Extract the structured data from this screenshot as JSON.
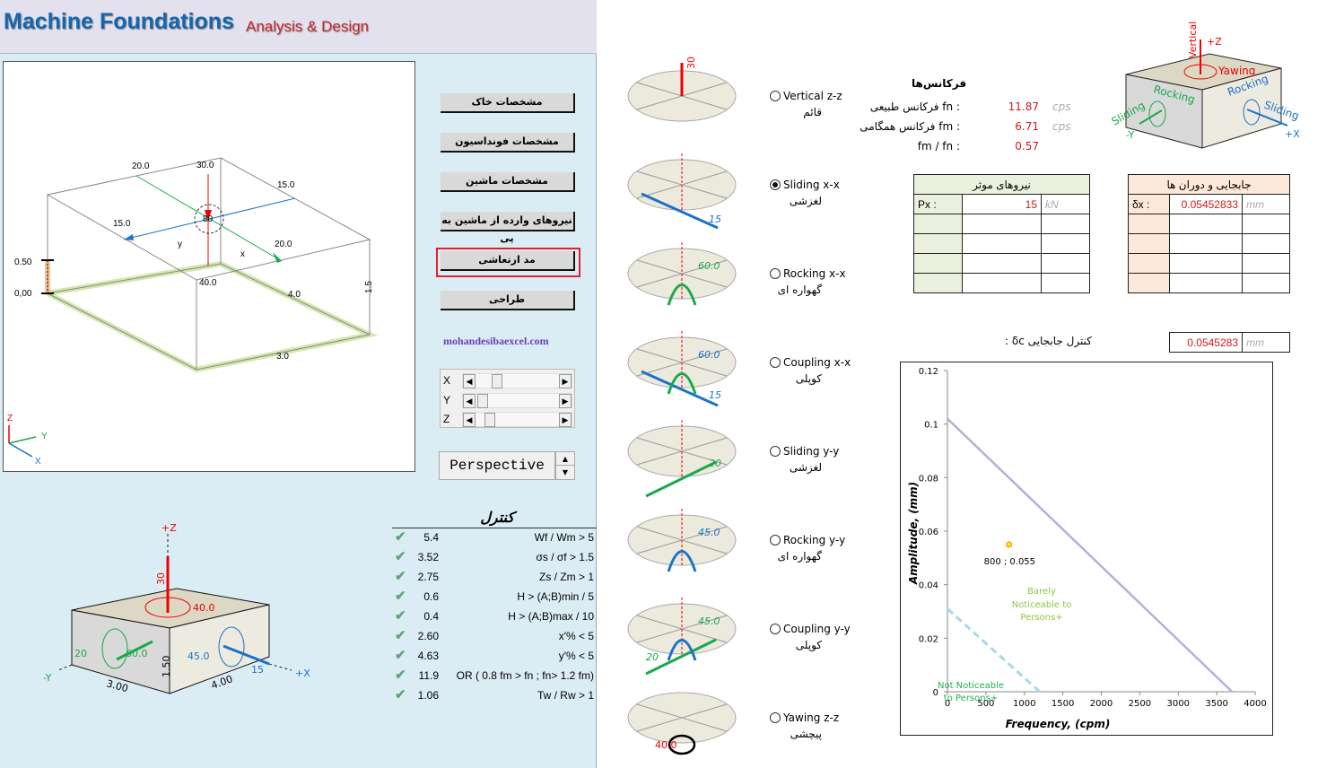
{
  "header": {
    "title": "Machine Foundations",
    "subtitle": "Analysis & Design"
  },
  "viewport": {
    "labels": [
      "20.0",
      "30.0",
      "15.0",
      "15.0",
      "20.0",
      "80",
      "y",
      "x",
      "40.0",
      "0.50",
      "0,00",
      "4.0",
      "3.0",
      "1.5"
    ],
    "axis": {
      "z": "Z",
      "y": "Y",
      "x": "X"
    }
  },
  "menu": {
    "buttons": [
      "مشخصات خاک",
      "مشخصات فونداسیون",
      "مشخصات ماشین",
      "نیروهای وارده از ماشین به پی",
      "مد ارتعاشی",
      "طراحی"
    ],
    "selected_index": 4,
    "site": "mohandesibaexcel.com"
  },
  "rotation": {
    "rows": [
      {
        "label": "X",
        "value": 0.3
      },
      {
        "label": "Y",
        "value": 0.05
      },
      {
        "label": "Z",
        "value": 0.12
      }
    ]
  },
  "projection": {
    "value": "Perspective"
  },
  "control": {
    "title": "کنترل",
    "rows": [
      {
        "value": "5.4",
        "cond": "Wf / Wm > 5"
      },
      {
        "value": "3.52",
        "cond": "σs / σf > 1.5"
      },
      {
        "value": "2.75",
        "cond": "Zs / Zm > 1"
      },
      {
        "value": "0.6",
        "cond": "H > (A;B)min / 5"
      },
      {
        "value": "0.4",
        "cond": "H > (A;B)max / 10"
      },
      {
        "value": "2.60",
        "cond": "x'% < 5"
      },
      {
        "value": "4.63",
        "cond": "y'% < 5"
      },
      {
        "value": "11.9",
        "cond": "OR ( 0.8 fm > fn ;  fn> 1.2 fm)"
      },
      {
        "value": "1.06",
        "cond": "Tw / Rw > 1"
      }
    ]
  },
  "box3d": {
    "plus_z": "+Z",
    "minus_y": "-Y",
    "plus_x": "+X",
    "vz": "30",
    "yaw": "40.0",
    "sy": "20",
    "ry": "60.0",
    "rx": "45.0",
    "sx": "15",
    "h": "1.50",
    "b": "3.00",
    "l": "4.00"
  },
  "modes": [
    {
      "en": "Vertical z-z",
      "fa": "قائم",
      "value": "30",
      "selected": false
    },
    {
      "en": "Sliding x-x",
      "fa": "لغزشی",
      "value": "15",
      "selected": true
    },
    {
      "en": "Rocking x-x",
      "fa": "گهواره ای",
      "value": "60.0",
      "selected": false
    },
    {
      "en": "Coupling x-x",
      "fa": "کوپلی",
      "value": "60.0",
      "value2": "15",
      "selected": false
    },
    {
      "en": "Sliding y-y",
      "fa": "لغزشی",
      "value": "20",
      "selected": false
    },
    {
      "en": "Rocking y-y",
      "fa": "گهواره ای",
      "value": "45.0",
      "selected": false
    },
    {
      "en": "Coupling y-y",
      "fa": "کوپلی",
      "value": "45.0",
      "value2": "20",
      "selected": false
    },
    {
      "en": "Yawing z-z",
      "fa": "پیچشی",
      "value": "40.0",
      "selected": false
    }
  ],
  "frequencies": {
    "title": "فرکانس‌ها",
    "rows": [
      {
        "label": "فرکانس طبیعی fn :",
        "value": "11.87",
        "unit": "cps"
      },
      {
        "label": "فرکانس همگامی fm :",
        "value": "6.71",
        "unit": "cps"
      },
      {
        "label": "fm / fn :",
        "value": "0.57",
        "unit": ""
      }
    ]
  },
  "legend_box": {
    "vertical": "Vertical",
    "plus_z": "+Z",
    "yawing": "Yawing",
    "rocking_y": "Rocking",
    "sliding_y": "Sliding",
    "minus_y": "-Y",
    "rocking_x": "Rocking",
    "sliding_x": "Sliding",
    "plus_x": "+X"
  },
  "forces": {
    "title": "نیروهای موثر",
    "label": "Px :",
    "value": "15",
    "unit": "kN"
  },
  "displacements": {
    "title": "جابجایی و دوران ها",
    "label": "δx :",
    "value": "0.05452833",
    "unit": "mm"
  },
  "disp_control": {
    "label": "کنترل جابجایی δc :",
    "value": "0.0545283",
    "unit": "mm"
  },
  "chart_data": {
    "type": "line",
    "xlabel": "Frequency, (cpm)",
    "ylabel": "Amplitude, (mm)",
    "xlim": [
      0,
      4000
    ],
    "ylim": [
      0,
      0.12
    ],
    "xticks": [
      "0",
      "500",
      "1000",
      "1500",
      "2000",
      "2500",
      "3000",
      "3500",
      "4000"
    ],
    "yticks": [
      "0",
      "0.02",
      "0.04",
      "0.06",
      "0.08",
      "0.1",
      "0.12"
    ],
    "series": [
      {
        "x": [
          0,
          3700
        ],
        "y": [
          0.102,
          0
        ],
        "color": "#b9aed6",
        "style": "solid"
      },
      {
        "x": [
          0,
          1200
        ],
        "y": [
          0.031,
          0
        ],
        "color": "#a9d8e6",
        "style": "dashed"
      }
    ],
    "point": {
      "x": 800,
      "y": 0.055,
      "label": "800 ; 0.055"
    },
    "annotations": [
      {
        "text": "Barely",
        "color": "#8cc63f"
      },
      {
        "text": "Noticeable to",
        "color": "#8cc63f"
      },
      {
        "text": "Persons+",
        "color": "#8cc63f"
      },
      {
        "text": "Not Noticeable",
        "color": "#1db34f"
      },
      {
        "text": "to Persons+",
        "color": "#1db34f"
      }
    ],
    "grid": false
  }
}
